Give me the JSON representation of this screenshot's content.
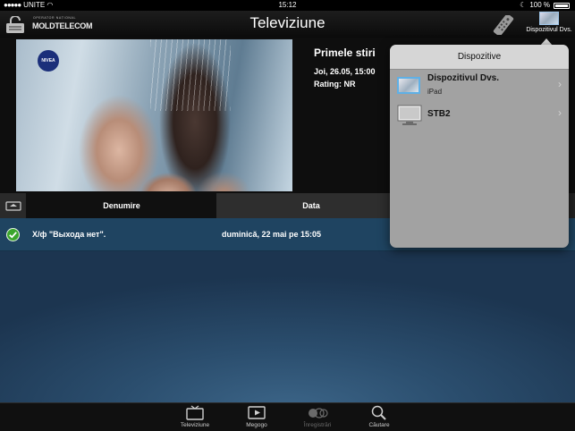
{
  "status_bar": {
    "signal": "●●●●●",
    "carrier": "UNITE",
    "time": "15:12",
    "battery": "100 %"
  },
  "header": {
    "logo_sub": "OPERATOR NAȚIONAL",
    "logo_main": "MOLDTELECOM",
    "title": "Televiziune",
    "device_button_label": "Dispozitivul Dvs."
  },
  "program": {
    "channel_logo": "NIVEA",
    "title": "Primele stiri",
    "date": "Joi, 26.05, 15:00",
    "rating": "Rating: NR"
  },
  "list": {
    "columns": [
      "Denumire",
      "Data"
    ],
    "rows": [
      {
        "name": "Х/ф \"Выхода нет\".",
        "date": "duminică, 22 mai pe 15:05",
        "status": "recorded"
      }
    ]
  },
  "popover": {
    "title": "Dispozitive",
    "devices": [
      {
        "name": "Dispozitivul Dvs.",
        "type": "iPad",
        "icon": "ipad-icon",
        "selected": true
      },
      {
        "name": "STB2",
        "type": "",
        "icon": "tv-icon",
        "selected": false
      }
    ]
  },
  "tabs": [
    {
      "label": "Televiziune",
      "icon": "tv-icon",
      "enabled": true
    },
    {
      "label": "Megogo",
      "icon": "play-icon",
      "enabled": true
    },
    {
      "label": "Înregistrări",
      "icon": "record-icon",
      "enabled": false
    },
    {
      "label": "Căutare",
      "icon": "search-icon",
      "enabled": true
    }
  ],
  "colors": {
    "accent_blue": "#2b4e6e",
    "popover_bg": "#a2a2a2",
    "check_green": "#3aa52c"
  }
}
